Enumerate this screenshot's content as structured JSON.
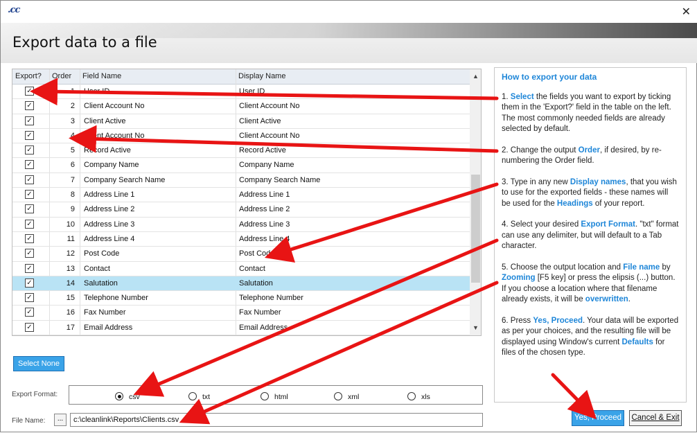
{
  "window": {
    "logo": ".cc",
    "close_glyph": "✕",
    "title": "Export data to a file"
  },
  "grid": {
    "headers": {
      "export": "Export?",
      "order": "Order",
      "field": "Field Name",
      "display": "Display Name"
    },
    "rows": [
      {
        "checked": true,
        "order": "1",
        "field": "User ID",
        "display": "User ID"
      },
      {
        "checked": true,
        "order": "2",
        "field": "Client Account No",
        "display": "Client Account No"
      },
      {
        "checked": true,
        "order": "3",
        "field": "Client Active",
        "display": "Client Active"
      },
      {
        "checked": true,
        "order": "4",
        "field": "Client Account No",
        "display": "Client Account No"
      },
      {
        "checked": true,
        "order": "5",
        "field": "Record Active",
        "display": "Record Active"
      },
      {
        "checked": true,
        "order": "6",
        "field": "Company Name",
        "display": "Company Name"
      },
      {
        "checked": true,
        "order": "7",
        "field": "Company Search Name",
        "display": "Company Search Name"
      },
      {
        "checked": true,
        "order": "8",
        "field": "Address Line 1",
        "display": "Address Line 1"
      },
      {
        "checked": true,
        "order": "9",
        "field": "Address Line 2",
        "display": "Address Line 2"
      },
      {
        "checked": true,
        "order": "10",
        "field": "Address Line 3",
        "display": "Address Line 3"
      },
      {
        "checked": true,
        "order": "11",
        "field": "Address Line 4",
        "display": "Address Line 4"
      },
      {
        "checked": true,
        "order": "12",
        "field": "Post Code",
        "display": "Post Code"
      },
      {
        "checked": true,
        "order": "13",
        "field": "Contact",
        "display": "Contact"
      },
      {
        "checked": true,
        "order": "14",
        "field": "Salutation",
        "display": "Salutation",
        "selected": true
      },
      {
        "checked": true,
        "order": "15",
        "field": "Telephone Number",
        "display": "Telephone Number"
      },
      {
        "checked": true,
        "order": "16",
        "field": "Fax Number",
        "display": "Fax Number"
      },
      {
        "checked": true,
        "order": "17",
        "field": "Email Address",
        "display": "Email Address"
      }
    ],
    "check_glyph": "✓",
    "scroll_up": "▲",
    "scroll_down": "▼"
  },
  "help": {
    "title": "How to export your data",
    "steps": [
      [
        {
          "t": "1. "
        },
        {
          "t": "Select",
          "kw": true
        },
        {
          "t": " the fields you want to export by ticking them in the 'Export?' field in the table on the left. The most commonly needed fields are already selected by default."
        }
      ],
      [
        {
          "t": "2. Change the output "
        },
        {
          "t": "Order",
          "kw": true
        },
        {
          "t": ", if desired, by re-numbering the Order field."
        }
      ],
      [
        {
          "t": "3. Type in any new "
        },
        {
          "t": "Display names",
          "kw": true
        },
        {
          "t": ", that you wish to use for the exported fields - these names will be used for the "
        },
        {
          "t": "Headings",
          "kw": true
        },
        {
          "t": " of your report."
        }
      ],
      [
        {
          "t": "4. Select your desired "
        },
        {
          "t": "Export Format",
          "kw": true
        },
        {
          "t": ". \"txt\" format can use any delimiter, but will default to a Tab character."
        }
      ],
      [
        {
          "t": "5. Choose the output location and "
        },
        {
          "t": "File name",
          "kw": true
        },
        {
          "t": " by "
        },
        {
          "t": "Zooming",
          "kw": true
        },
        {
          "t": " [F5 key] or press the elipsis (...) button. If you choose a location where that filename already exists, it will be "
        },
        {
          "t": "overwritten",
          "kw": true
        },
        {
          "t": "."
        }
      ],
      [
        {
          "t": "6. Press "
        },
        {
          "t": "Yes, Proceed",
          "kw": true
        },
        {
          "t": ". Your data will be exported as per your choices, and the resulting file will be displayed using Window's current "
        },
        {
          "t": "Defaults",
          "kw": true
        },
        {
          "t": " for files of the chosen type."
        }
      ]
    ]
  },
  "buttons": {
    "select_none": "Select None",
    "proceed": "Yes, Proceed",
    "cancel": "Cancel & Exit",
    "ellipsis": "..."
  },
  "format": {
    "label": "Export Format:",
    "options": [
      {
        "label": "csv",
        "selected": true
      },
      {
        "label": "txt"
      },
      {
        "label": "html"
      },
      {
        "label": "xml"
      },
      {
        "label": "xls"
      }
    ]
  },
  "file": {
    "label": "File Name:",
    "value": "c:\\cleanlink\\Reports\\Clients.csv"
  },
  "colors": {
    "accent": "#1e86d8",
    "button": "#3aa3e8",
    "selected_row": "#b9e3f5",
    "arrow": "#e81414"
  }
}
